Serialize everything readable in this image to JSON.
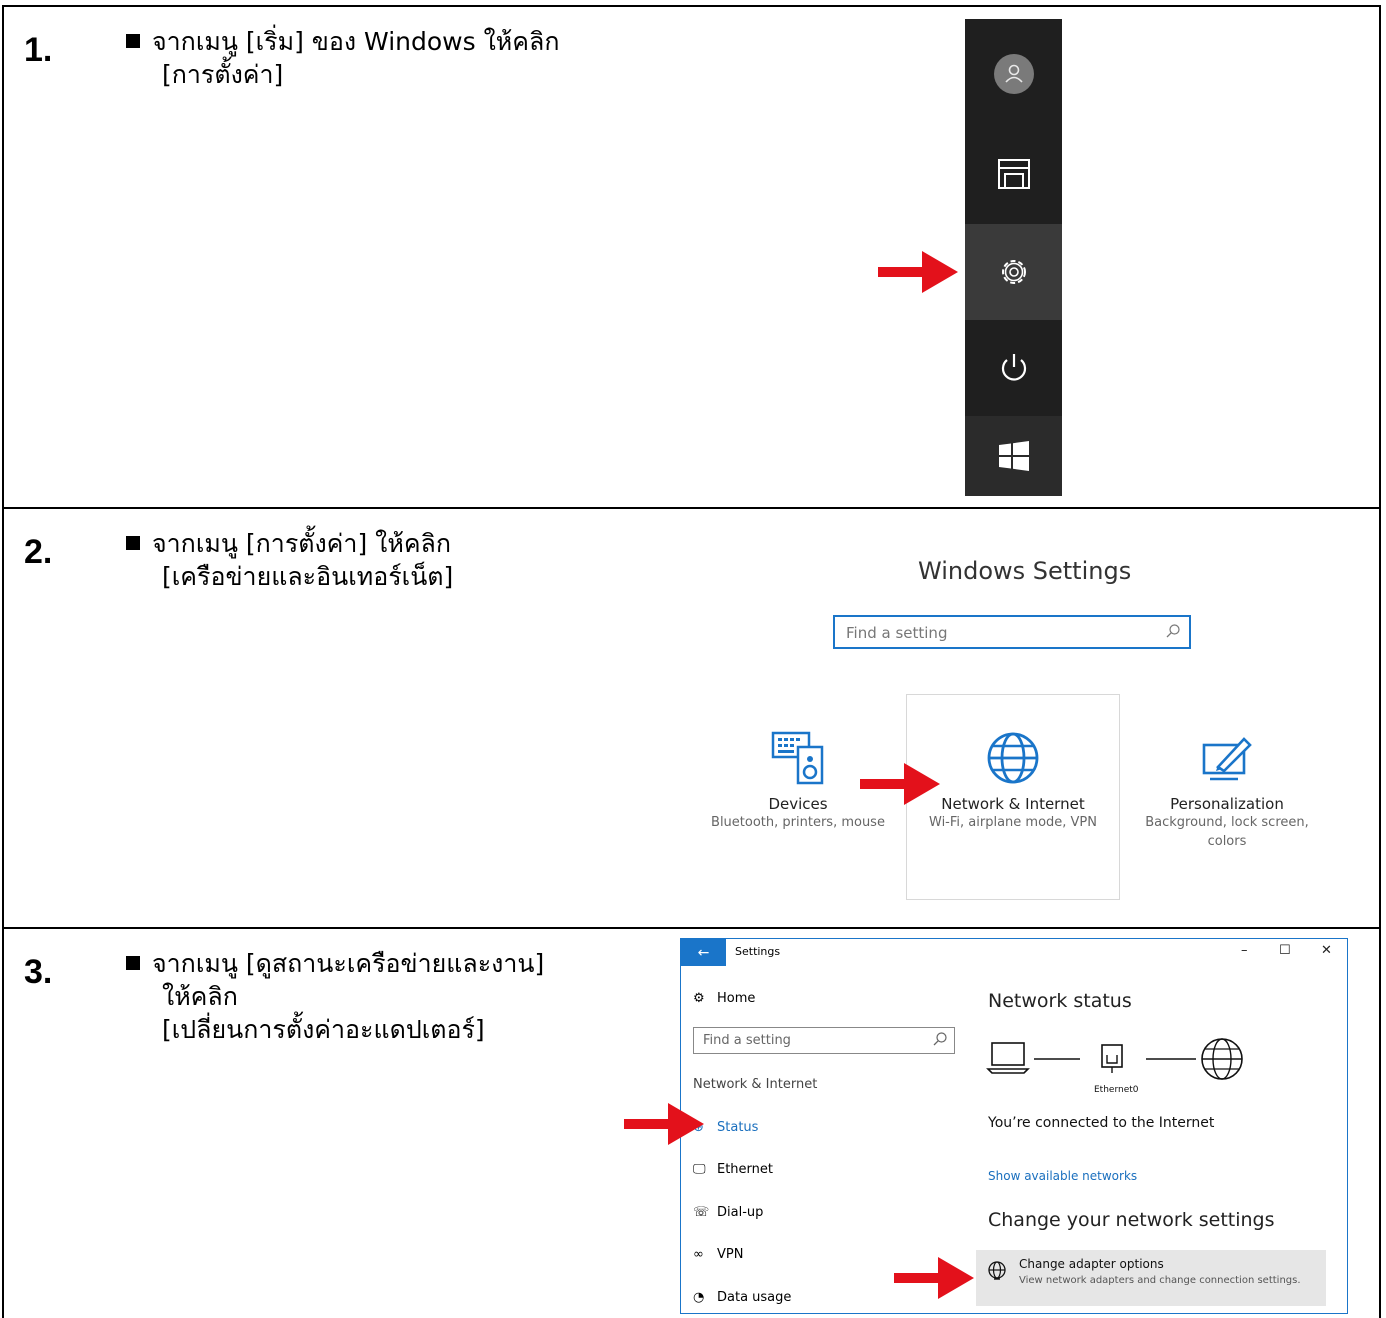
{
  "steps": [
    {
      "number": "1.",
      "lines": [
        "จากเมนู [เริ่ม] ของ Windows ให้คลิก",
        "[การตั้งค่า]"
      ]
    },
    {
      "number": "2.",
      "lines": [
        "จากเมนู   [การตั้งค่า] ให้คลิก",
        "[เครือข่ายและอินเทอร์เน็ต]"
      ]
    },
    {
      "number": "3.",
      "lines": [
        "จากเมนู   [ดูสถานะเครือข่ายและงาน]",
        "ให้คลิก",
        "[เปลี่ยนการตั้งค่าอะแดปเตอร์]"
      ]
    }
  ],
  "start_menu": {
    "icons": [
      "user-avatar-icon",
      "documents-icon",
      "gear-icon",
      "power-icon",
      "windows-logo-icon"
    ],
    "highlighted": "gear-icon"
  },
  "windows_settings": {
    "title": "Windows Settings",
    "search_placeholder": "Find a setting",
    "tiles": [
      {
        "title": "Devices",
        "subtitle": "Bluetooth, printers, mouse",
        "icon": "devices-icon"
      },
      {
        "title": "Network & Internet",
        "subtitle": "Wi-Fi, airplane mode, VPN",
        "icon": "globe-icon"
      },
      {
        "title": "Personalization",
        "subtitle_line1": "Background, lock screen,",
        "subtitle_line2": "colors",
        "icon": "personalization-icon"
      }
    ]
  },
  "settings_window": {
    "title": "Settings",
    "window_controls": [
      "–",
      "☐",
      "✕"
    ],
    "sidebar": {
      "home": "Home",
      "search_placeholder": "Find a setting",
      "section": "Network & Internet",
      "items": [
        {
          "label": "Status",
          "icon": "status-icon",
          "selected": true
        },
        {
          "label": "Ethernet",
          "icon": "ethernet-icon"
        },
        {
          "label": "Dial-up",
          "icon": "dialup-icon"
        },
        {
          "label": "VPN",
          "icon": "vpn-icon"
        },
        {
          "label": "Data usage",
          "icon": "data-usage-icon"
        }
      ]
    },
    "main": {
      "network_status_heading": "Network status",
      "adapter_label": "Ethernet0",
      "connected_text": "You’re connected to the Internet",
      "show_networks_link": "Show available networks",
      "change_heading": "Change your network settings",
      "adapter_option_title": "Change adapter options",
      "adapter_option_desc": "View network adapters and change connection settings."
    }
  },
  "colors": {
    "accent": "#1a75c9",
    "arrow": "#e3111b",
    "start_bg": "#1f1f1f"
  }
}
